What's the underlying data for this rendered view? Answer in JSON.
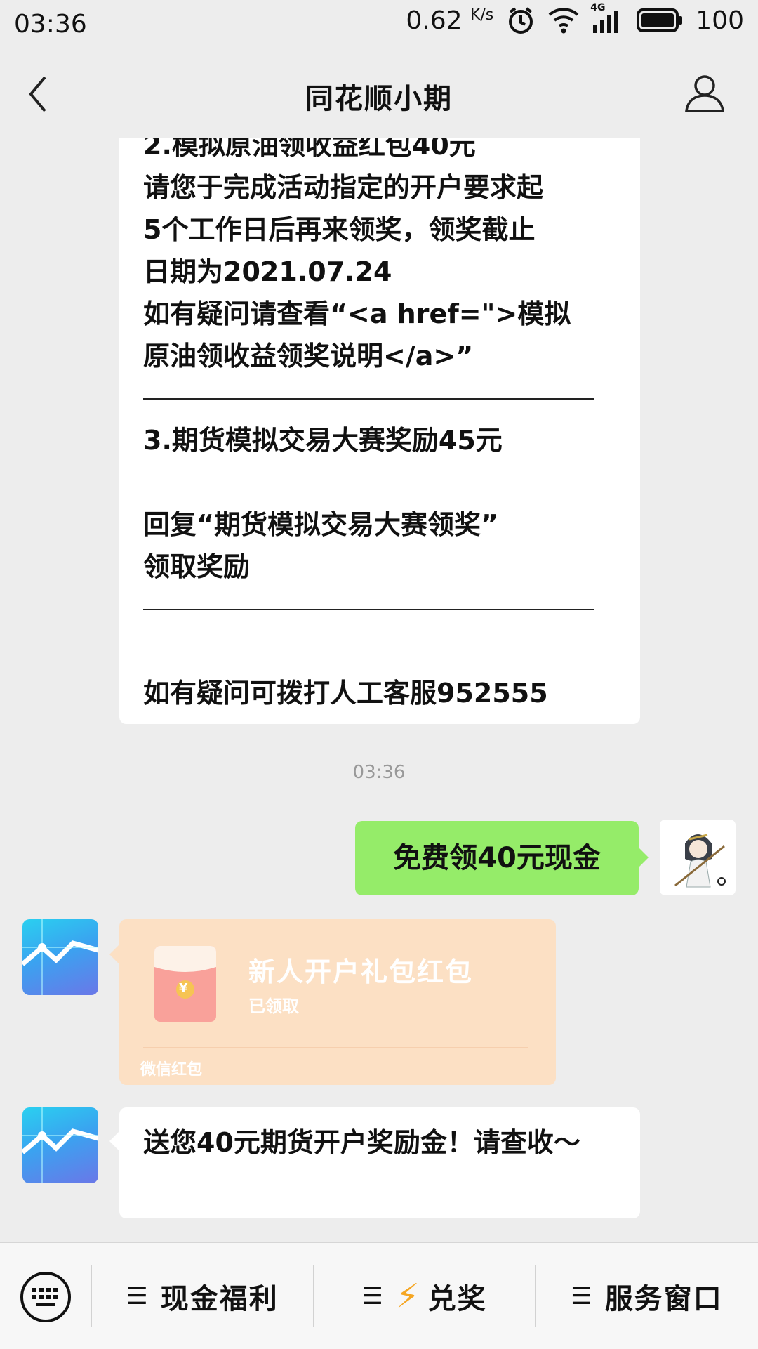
{
  "status_bar": {
    "time": "03:36",
    "net_speed": "0.62",
    "net_speed_unit": "K/s",
    "signal_label": "4G",
    "battery": "100"
  },
  "header": {
    "title": "同花顺小期"
  },
  "messages": {
    "long_message": {
      "lines": [
        "2.模拟原油领收益红包40元",
        "请您于完成活动指定的开户要求起",
        "5个工作日后再来领奖，领奖截止",
        "日期为2021.07.24",
        "如有疑问请查看“<a href=\">模拟",
        "原油领收益领奖说明</a>”",
        "3.期货模拟交易大赛奖励45元",
        "回复“期货模拟交易大赛领奖”",
        "领取奖励",
        "如有疑问可拨打人工客服952555"
      ]
    },
    "timestamp": "03:36",
    "user_message": "免费领40元现金",
    "red_packet": {
      "title": "新人开户礼包红包",
      "status": "已领取",
      "footer": "微信红包",
      "symbol": "¥"
    },
    "reward_message": "送您40元期货开户奖励金！请查收～"
  },
  "bottom_menu": {
    "items": [
      {
        "label": "现金福利"
      },
      {
        "label": "兑奖"
      },
      {
        "label": "服务窗口"
      }
    ]
  },
  "colors": {
    "background": "#ededed",
    "user_bubble": "#95ec69",
    "red_packet_bg": "#fce0c4",
    "envelope_red": "#f9a19a",
    "bolt": "#f5a623"
  }
}
